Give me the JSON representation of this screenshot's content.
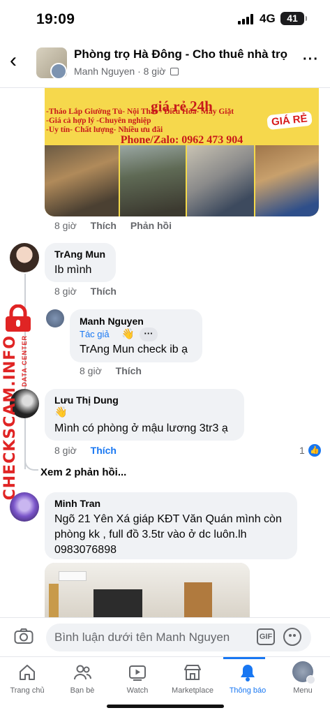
{
  "status_bar": {
    "time": "19:09",
    "network": "4G",
    "battery": "41"
  },
  "header": {
    "title": "Phòng trọ Hà Đông - Cho thuê nhà trọ",
    "author": "Manh Nguyen",
    "time": "8 giờ"
  },
  "post_image": {
    "headline": "giá rẻ 24h",
    "lines": [
      "-Tháo Lắp Giường Tủ- Nội Thất - Điều Hòa- Máy Giặt",
      "-Giá cả hợp lý -Chuyên nghiệp",
      "-Uy tín- Chất lượng- Nhiều ưu đãi"
    ],
    "badge": "GIÁ RẺ",
    "phone": "Phone/Zalo: 0962 473 904"
  },
  "post_meta": {
    "time": "8 giờ",
    "like": "Thích",
    "reply": "Phản hồi"
  },
  "comments": [
    {
      "name": "TrAng Mun",
      "text": "Ib mình",
      "time": "8 giờ",
      "like": "Thích"
    },
    {
      "name": "Manh Nguyen",
      "badge": "Tác giả",
      "text": "TrAng Mun check ib ạ",
      "time": "8 giờ",
      "like": "Thích"
    },
    {
      "name": "Lưu Thị Dung",
      "text": "Mình có phòng ở mậu lương 3tr3 ạ",
      "time": "8 giờ",
      "like": "Thích",
      "like_count": "1"
    },
    {
      "name": "Minh Tran",
      "lines": [
        "Ngõ 21 Yên Xá giáp KĐT Văn Quán mình còn",
        "phòng kk , full đồ 3.5tr vào ở dc luôn.lh",
        "0983076898"
      ]
    }
  ],
  "see_more_replies": "Xem 2 phản hồi...",
  "watermark": {
    "text": "CHECKSCAM.INFO",
    "sub": "DATA CENTER"
  },
  "composer": {
    "placeholder": "Bình luận dưới tên Manh Nguyen",
    "gif": "GIF"
  },
  "tabs": [
    {
      "label": "Trang chủ",
      "icon": "home-icon"
    },
    {
      "label": "Bạn bè",
      "icon": "friends-icon"
    },
    {
      "label": "Watch",
      "icon": "watch-icon"
    },
    {
      "label": "Marketplace",
      "icon": "marketplace-icon"
    },
    {
      "label": "Thông báo",
      "icon": "bell-icon",
      "active": true
    },
    {
      "label": "Menu",
      "icon": "menu-avatar-icon"
    }
  ],
  "colors": {
    "accent": "#1877f2",
    "watermark": "#e02424",
    "banner": "#f6d84c"
  }
}
